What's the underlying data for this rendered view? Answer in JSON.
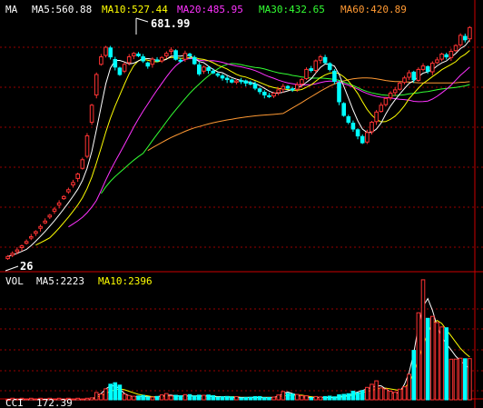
{
  "price_panel": {
    "label": "MA",
    "ma5": {
      "text": "MA5:560.88",
      "color": "#ffffff"
    },
    "ma10": {
      "text": "MA10:527.44",
      "color": "#ffff00"
    },
    "ma20": {
      "text": "MA20:485.95",
      "color": "#ff33ff"
    },
    "ma30": {
      "text": "MA30:432.65",
      "color": "#33ff33"
    },
    "ma60": {
      "text": "MA60:420.89",
      "color": "#ff9933"
    }
  },
  "volume_panel": {
    "label": "VOL",
    "ma5": {
      "text": "MA5:2223",
      "color": "#ffffff"
    },
    "ma10": {
      "text": "MA10:2396",
      "color": "#ffff00"
    }
  },
  "cci_panel": {
    "label": "CCI",
    "value": "172.39"
  },
  "chart_data": {
    "type": "candlestick",
    "xlabel": "",
    "ylabel": "",
    "ylim": [
      0,
      720
    ],
    "grid": true,
    "annotations": [
      {
        "text": "681.99",
        "kind": "high",
        "x_index": 21,
        "y": 681.99
      },
      {
        "text": "26",
        "kind": "low",
        "x_index": 0,
        "y": 26
      }
    ],
    "up_color": "#ff3333",
    "down_color": "#00ffff",
    "close": [
      26,
      35,
      45,
      57,
      70,
      84,
      99,
      114,
      130,
      147,
      165,
      183,
      202,
      222,
      243,
      268,
      310,
      380,
      470,
      560,
      612,
      640,
      612,
      582,
      560,
      590,
      612,
      622,
      615,
      600,
      585,
      605,
      600,
      610,
      622,
      632,
      605,
      600,
      622,
      615,
      592,
      562,
      582,
      572,
      565,
      558,
      550,
      545,
      538,
      541,
      540,
      535,
      532,
      520,
      510,
      500,
      495,
      505,
      515,
      525,
      520,
      515,
      530,
      545,
      575,
      572,
      600,
      612,
      595,
      575,
      540,
      480,
      440,
      420,
      400,
      380,
      360,
      390,
      420,
      450,
      470,
      490,
      505,
      515,
      535,
      550,
      565,
      545,
      575,
      585,
      570,
      593,
      603,
      620,
      612,
      628,
      645,
      675,
      662,
      698
    ],
    "open": [
      20,
      30,
      40,
      52,
      65,
      80,
      94,
      109,
      125,
      142,
      159,
      177,
      196,
      216,
      236,
      255,
      285,
      320,
      420,
      500,
      590,
      616,
      638,
      604,
      579,
      570,
      595,
      615,
      620,
      612,
      594,
      590,
      603,
      600,
      615,
      628,
      630,
      602,
      605,
      620,
      610,
      588,
      570,
      580,
      570,
      562,
      556,
      549,
      544,
      537,
      542,
      541,
      536,
      532,
      518,
      508,
      498,
      497,
      507,
      517,
      525,
      518,
      517,
      532,
      548,
      577,
      572,
      602,
      610,
      592,
      570,
      535,
      475,
      436,
      417,
      398,
      378,
      362,
      392,
      422,
      452,
      472,
      492,
      507,
      517,
      537,
      552,
      567,
      543,
      575,
      583,
      568,
      595,
      605,
      618,
      610,
      630,
      647,
      672,
      665
    ],
    "vol_ma5": [
      0,
      0,
      0,
      0,
      0,
      0,
      0,
      0,
      0,
      0,
      0,
      0,
      0,
      0,
      0,
      0,
      0,
      0,
      0,
      5,
      8,
      14,
      18,
      18,
      14,
      8,
      5,
      4,
      4,
      4,
      4,
      3,
      4,
      5,
      6,
      6,
      5,
      5,
      5,
      5,
      5,
      5,
      5,
      5,
      4,
      4,
      4,
      4,
      3,
      3,
      3,
      3,
      3,
      3,
      3,
      3,
      3,
      3,
      5,
      8,
      10,
      8,
      6,
      4,
      3,
      3,
      3,
      3,
      3,
      3,
      3,
      4,
      5,
      6,
      8,
      10,
      12,
      14,
      16,
      18,
      18,
      14,
      10,
      8,
      10,
      20,
      35,
      60,
      95,
      120,
      130,
      115,
      95,
      80,
      72,
      64,
      56,
      50,
      45,
      40
    ],
    "vol_ma10": [
      0,
      0,
      0,
      0,
      0,
      0,
      0,
      0,
      0,
      0,
      0,
      0,
      0,
      0,
      0,
      0,
      0,
      0,
      0,
      3,
      5,
      8,
      11,
      13,
      14,
      13,
      11,
      9,
      7,
      6,
      5,
      4,
      4,
      4,
      5,
      5,
      5,
      5,
      5,
      5,
      5,
      5,
      5,
      5,
      5,
      4,
      4,
      4,
      4,
      4,
      3,
      3,
      3,
      3,
      3,
      3,
      3,
      3,
      4,
      5,
      6,
      6,
      6,
      6,
      5,
      4,
      3,
      3,
      3,
      3,
      3,
      3,
      4,
      5,
      6,
      8,
      9,
      11,
      12,
      14,
      15,
      15,
      14,
      13,
      12,
      15,
      22,
      35,
      52,
      70,
      85,
      98,
      102,
      98,
      90,
      82,
      74,
      66,
      60,
      55
    ]
  }
}
